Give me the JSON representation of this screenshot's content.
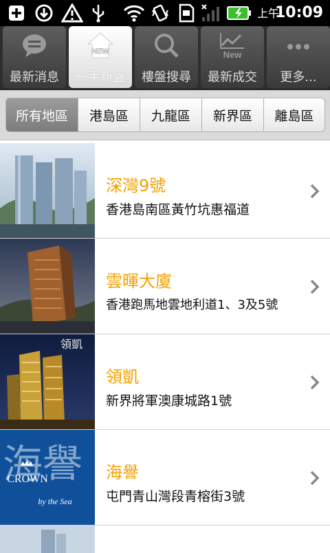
{
  "status_bar": {
    "ampm": "上午",
    "time": "10:09",
    "icons": [
      "add-icon",
      "download-icon",
      "warning-icon",
      "usb-icon",
      "wifi-icon",
      "vibrate-icon",
      "sd-card-icon",
      "signal-icon",
      "battery-charging-icon"
    ]
  },
  "tabs": [
    {
      "label": "最新消息",
      "icon": "speech-bubble-icon",
      "active": false
    },
    {
      "label": "一手新盤",
      "icon": "new-home-icon",
      "active": true,
      "badge": "NEW"
    },
    {
      "label": "樓盤搜尋",
      "icon": "search-icon",
      "active": false
    },
    {
      "label": "最新成交",
      "icon": "new-chart-icon",
      "active": false,
      "badge": "New"
    },
    {
      "label": "更多...",
      "icon": "more-dots-icon",
      "active": false
    }
  ],
  "regions": [
    {
      "label": "所有地區",
      "active": true
    },
    {
      "label": "港島區",
      "active": false
    },
    {
      "label": "九龍區",
      "active": false
    },
    {
      "label": "新界區",
      "active": false
    },
    {
      "label": "離島區",
      "active": false
    }
  ],
  "listings": [
    {
      "title": "深灣9號",
      "address": "香港島南區黃竹坑惠福道",
      "image": "twin-towers-photo"
    },
    {
      "title": "雲暉大廈",
      "address": "香港跑馬地雲地利道1、3及5號",
      "image": "brown-tower-photo"
    },
    {
      "title": "領凱",
      "address": "新界將軍澳康城路1號",
      "image": "gold-towers-photo",
      "image_caption": "領凱"
    },
    {
      "title": "海譽",
      "address": "屯門青山灣段青榕街3號",
      "image": "crown-by-the-sea-logo",
      "logo_text": {
        "crown": "CROWN",
        "byline": "by the Sea",
        "chinese": "海譽"
      }
    }
  ],
  "accent_color": "#f5a000"
}
